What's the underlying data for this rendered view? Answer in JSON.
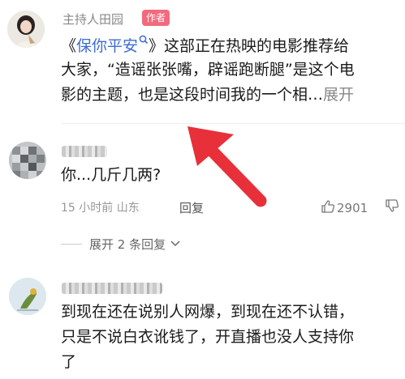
{
  "post": {
    "author": "主持人田园",
    "badge": "作者",
    "line1_before": "《",
    "link_text": "保你平安",
    "line1_after": "》这部正在热映的电影推荐给",
    "line2": "大家，“造谣张张嘴，辟谣跑断腿”是这个电",
    "line3": "影的主题，也是这段时间我的一个相…",
    "more": "展开"
  },
  "comment1": {
    "text": "你...几斤几两?",
    "meta": "15 小时前 山东",
    "reply": "回复",
    "likes": "2901",
    "expand": "展开 2 条回复"
  },
  "comment2": {
    "line1": "到现在还在说别人网爆，到现在还不认错，",
    "line2": "只是不说白衣讹钱了，开直播也没人支持你",
    "line3": "了"
  },
  "colors": {
    "link": "#3d6bd7",
    "badge": "#f26a7d",
    "arrow": "#e8303a"
  },
  "icons": [
    "search-icon",
    "thumbs-up-icon",
    "thumbs-down-icon",
    "chevron-down-icon",
    "arrow-annotation"
  ]
}
